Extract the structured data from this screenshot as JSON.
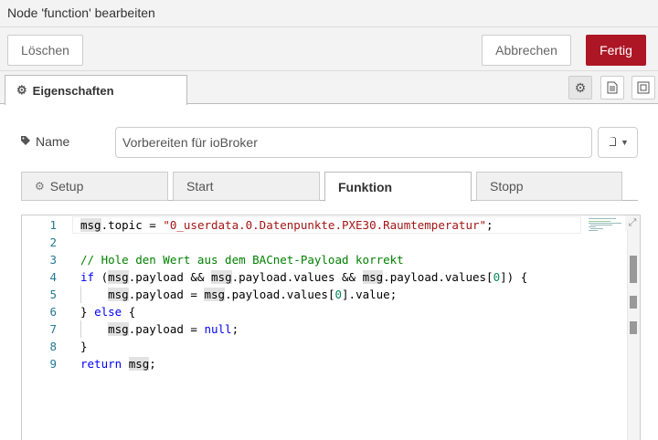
{
  "header": {
    "title": "Node 'function' bearbeiten"
  },
  "actions": {
    "delete_label": "Löschen",
    "cancel_label": "Abbrechen",
    "done_label": "Fertig"
  },
  "tabs": {
    "main_label": "Eigenschaften"
  },
  "form": {
    "name_label": "Name",
    "name_value": "Vorbereiten für ioBroker"
  },
  "subtabs": {
    "setup": "Setup",
    "start": "Start",
    "function": "Funktion",
    "stop": "Stopp"
  },
  "editor": {
    "line_numbers": [
      "1",
      "2",
      "3",
      "4",
      "5",
      "6",
      "7",
      "8",
      "9"
    ],
    "lines": [
      "msg.topic = \"0_userdata.0.Datenpunkte.PXE30.Raumtemperatur\";",
      "",
      "// Hole den Wert aus dem BACnet-Payload korrekt",
      "if (msg.payload && msg.payload.values && msg.payload.values[0]) {",
      "    msg.payload = msg.payload.values[0].value;",
      "} else {",
      "    msg.payload = null;",
      "}",
      "return msg;"
    ]
  },
  "icons": {
    "gear": "gear-icon",
    "tag": "tag-icon",
    "book": "book-icon",
    "doc": "document-icon",
    "frame": "frame-icon",
    "expand": "expand-icon"
  },
  "colors": {
    "primary": "#ad1625",
    "keyword": "#0000ff",
    "string": "#a31515",
    "comment": "#008000",
    "number": "#098658"
  }
}
